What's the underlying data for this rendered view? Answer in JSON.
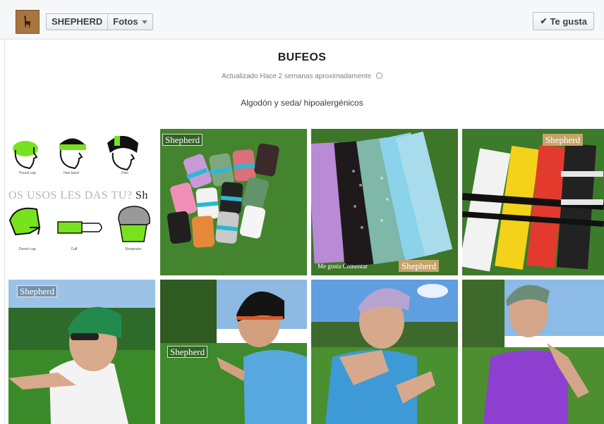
{
  "header": {
    "page_name": "SHEPHERD",
    "section": "Fotos",
    "like_label": "Te gusta",
    "like_icon": "checkmark-icon",
    "dropdown_icon": "caret-down-icon"
  },
  "album": {
    "title": "BUFEOS",
    "updated": "Actualizado Hace 2 semanas aproximadamente",
    "privacy_icon": "globe-icon",
    "description": "Algodón y seda/ hipoalergénicos"
  },
  "photos": {
    "usage": {
      "headline": "OS USOS LES DAS TU?",
      "headline_tail": " Sh",
      "captions": [
        "Pound cap",
        "Hair band",
        "Filet",
        "Desert cap",
        "Cuff",
        "Respirator"
      ]
    },
    "watermark": "Shepherd",
    "watermark_secondary": "Me gusta  Comentar",
    "items": [
      {
        "subject": "usage-infographic"
      },
      {
        "subject": "rolled-bufeos-on-grass"
      },
      {
        "subject": "bufeos-flat-lay-pastel"
      },
      {
        "subject": "bufeos-flat-lay-stripes"
      },
      {
        "subject": "man-green-bufeo"
      },
      {
        "subject": "man-black-bufeo"
      },
      {
        "subject": "man-lilac-bufeo"
      },
      {
        "subject": "man-grey-bufeo"
      }
    ]
  },
  "colors": {
    "topbar_bg": "#f6f7f9",
    "grass": "#3f7a2b",
    "sky": "#7fb2e0",
    "accent_green": "#78e21e"
  }
}
